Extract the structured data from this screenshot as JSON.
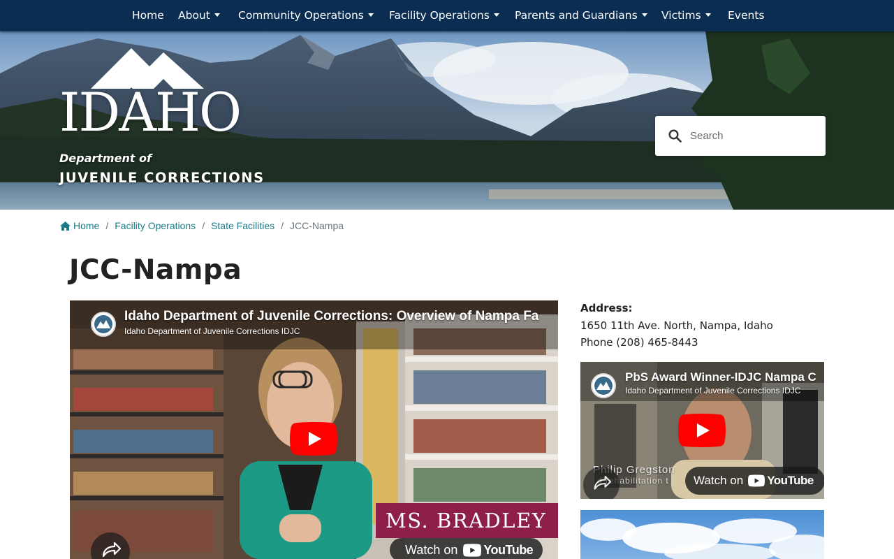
{
  "nav": {
    "items": [
      {
        "label": "Home",
        "dropdown": false
      },
      {
        "label": "About",
        "dropdown": true
      },
      {
        "label": "Community Operations",
        "dropdown": true
      },
      {
        "label": "Facility Operations",
        "dropdown": true
      },
      {
        "label": "Parents and Guardians",
        "dropdown": true
      },
      {
        "label": "Victims",
        "dropdown": true
      },
      {
        "label": "Events",
        "dropdown": false
      }
    ]
  },
  "header": {
    "logo": {
      "wordmark": "IDAHO",
      "dept": "Department of",
      "agency": "JUVENILE CORRECTIONS"
    },
    "search": {
      "placeholder": "Search",
      "value": "",
      "icon": "search-icon"
    }
  },
  "breadcrumb": {
    "items": [
      "Home",
      "Facility Operations",
      "State Facilities"
    ],
    "current": "JCC-Nampa",
    "separator": "/"
  },
  "page": {
    "title": "JCC-Nampa"
  },
  "main_video": {
    "title": "Idaho Department of Juvenile Corrections: Overview of Nampa Fa",
    "channel": "Idaho Department of Juvenile Corrections IDJC",
    "nameplate": "MS. BRADLEY",
    "watch_on": "Watch on",
    "youtube": "YouTube"
  },
  "contact": {
    "address_label": "Address:",
    "address": "1650 11th Ave. North, Nampa, Idaho",
    "phone": "Phone (208) 465-8443"
  },
  "side_video": {
    "title": "PbS Award Winner-IDJC Nampa C",
    "channel": "Idaho Department of Juvenile Corrections IDJC",
    "caption_line1": "Philip Gregston",
    "caption_line2": "d rehabilitation t",
    "watch_on": "Watch on",
    "youtube": "YouTube"
  },
  "colors": {
    "nav_bg": "#0b2d52",
    "link": "#1b7a86",
    "youtube_red": "#ff0000",
    "nameplate": "#8e1e4a"
  }
}
